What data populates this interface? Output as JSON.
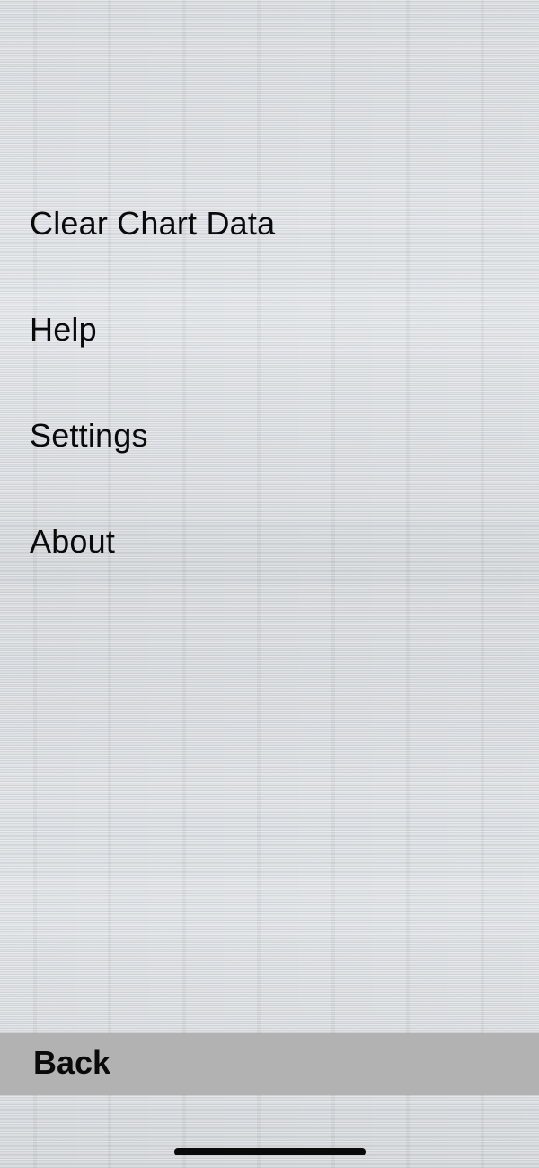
{
  "menu": {
    "items": [
      {
        "label": "Clear Chart Data"
      },
      {
        "label": "Help"
      },
      {
        "label": "Settings"
      },
      {
        "label": "About"
      }
    ]
  },
  "footer": {
    "back_label": "Back"
  },
  "colors": {
    "background": "#d6dade",
    "back_bar": "#b2b2b2",
    "text": "#0a0a0a"
  }
}
